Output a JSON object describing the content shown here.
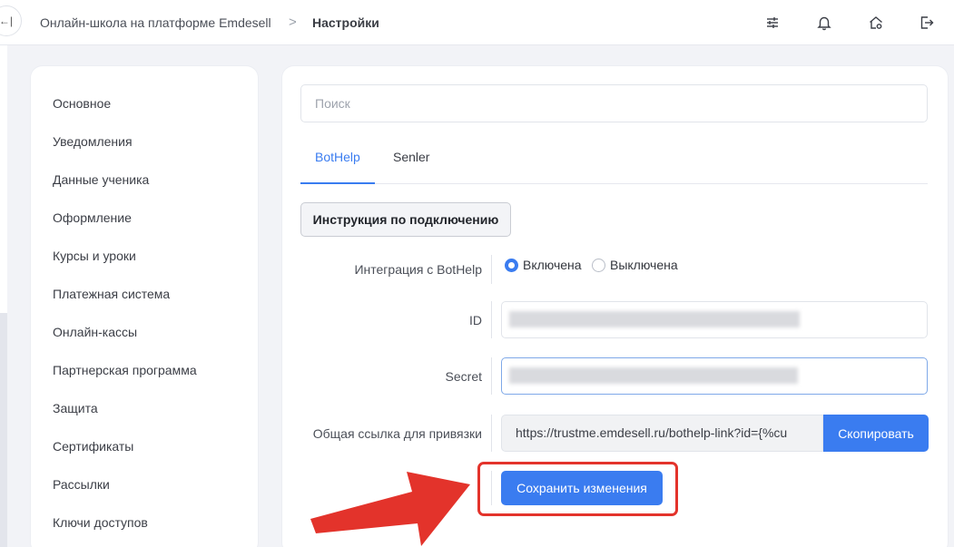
{
  "breadcrumb": {
    "parent": "Онлайн-школа на платформе Emdesell",
    "separator": ">",
    "current": "Настройки"
  },
  "topbar": {
    "collapse_glyph": "←|",
    "icons": [
      "sliders-icon",
      "bell-icon",
      "home-settings-icon",
      "logout-icon"
    ]
  },
  "sidebar": {
    "items": [
      {
        "label": "Основное"
      },
      {
        "label": "Уведомления"
      },
      {
        "label": "Данные ученика"
      },
      {
        "label": "Оформление"
      },
      {
        "label": "Курсы и уроки"
      },
      {
        "label": "Платежная система"
      },
      {
        "label": "Онлайн-кассы"
      },
      {
        "label": "Партнерская программа"
      },
      {
        "label": "Защита"
      },
      {
        "label": "Сертификаты"
      },
      {
        "label": "Рассылки"
      },
      {
        "label": "Ключи доступов"
      }
    ]
  },
  "main": {
    "search_placeholder": "Поиск",
    "tabs": [
      {
        "label": "BotHelp",
        "active": true
      },
      {
        "label": "Senler",
        "active": false
      }
    ],
    "instruction_button": "Инструкция по подключению",
    "integration": {
      "label": "Интеграция с BotHelp",
      "option_on": "Включена",
      "option_off": "Выключена",
      "selected": "Включена"
    },
    "id_label": "ID",
    "secret_label": "Secret",
    "link_label": "Общая ссылка для привязки",
    "link_value": "https://trustme.emdesell.ru/bothelp-link?id={%cu",
    "copy_button": "Скопировать",
    "save_button": "Сохранить изменения"
  },
  "colors": {
    "accent": "#3a7cf0",
    "highlight": "#e3332b",
    "background": "#f2f3f7"
  }
}
